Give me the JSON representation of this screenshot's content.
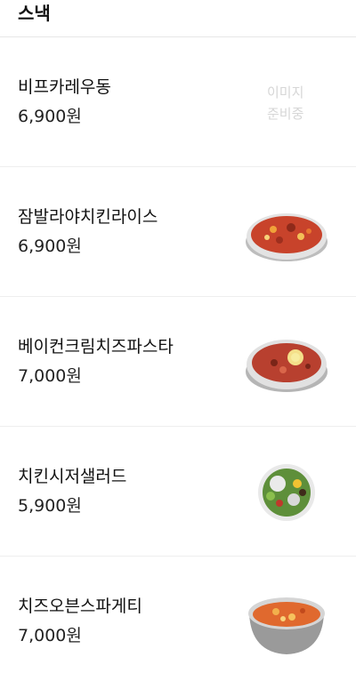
{
  "header": {
    "title": "스낵"
  },
  "menu": {
    "items": [
      {
        "name": "비프카레우동",
        "price": "6,900원",
        "image": "none",
        "no_image_text": "이미지 준비중"
      },
      {
        "name": "잠발라야치킨라이스",
        "price": "6,900원",
        "image": "jambalaya-dish-icon"
      },
      {
        "name": "베이컨크림치즈파스타",
        "price": "7,000원",
        "image": "pasta-dish-icon"
      },
      {
        "name": "치킨시저샐러드",
        "price": "5,900원",
        "image": "salad-bowl-icon"
      },
      {
        "name": "치즈오븐스파게티",
        "price": "7,000원",
        "image": "oven-spaghetti-icon"
      }
    ]
  },
  "colors": {
    "divider": "#eeeeee",
    "placeholder_text": "#d6d6d6",
    "text": "#111111"
  }
}
